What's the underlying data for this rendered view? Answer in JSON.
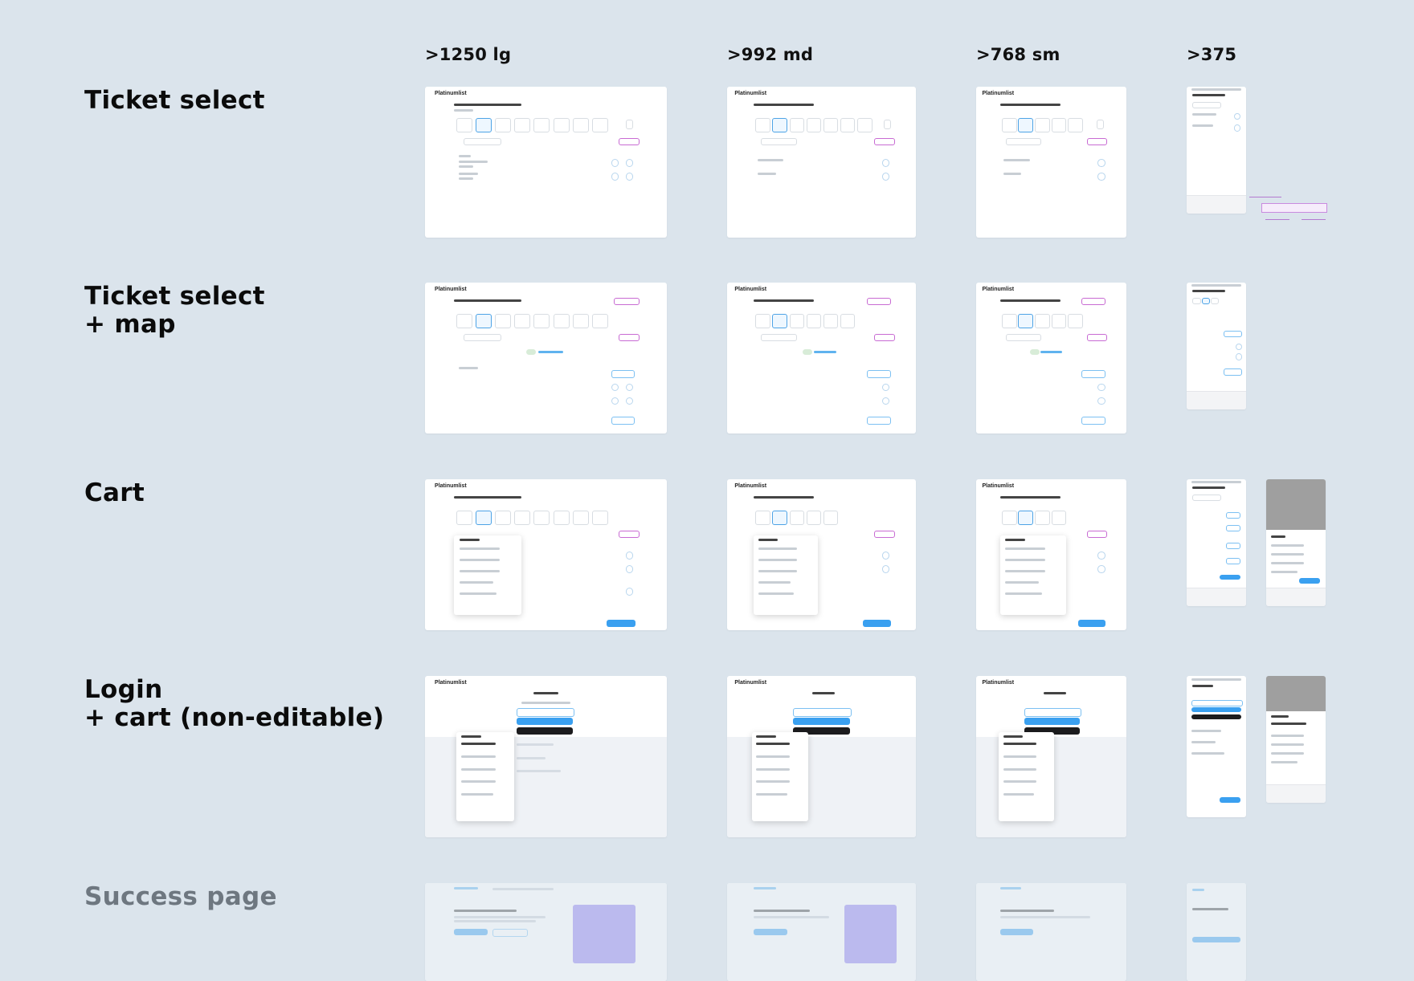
{
  "columns": [
    ">1250 lg",
    ">992 md",
    ">768 sm",
    ">375"
  ],
  "rows": [
    {
      "title_lines": [
        "Ticket select"
      ]
    },
    {
      "title_lines": [
        "Ticket select",
        "+ map"
      ]
    },
    {
      "title_lines": [
        "Cart"
      ]
    },
    {
      "title_lines": [
        "Login",
        "+ cart (non-editable)"
      ]
    },
    {
      "title_lines": [
        "Success page"
      ]
    }
  ],
  "thumb": {
    "logo": "Platinumlist"
  },
  "colors": {
    "background": "#dbe4ec",
    "accent_blue": "#3aa0f0",
    "promo_pink": "#c86bd3"
  }
}
